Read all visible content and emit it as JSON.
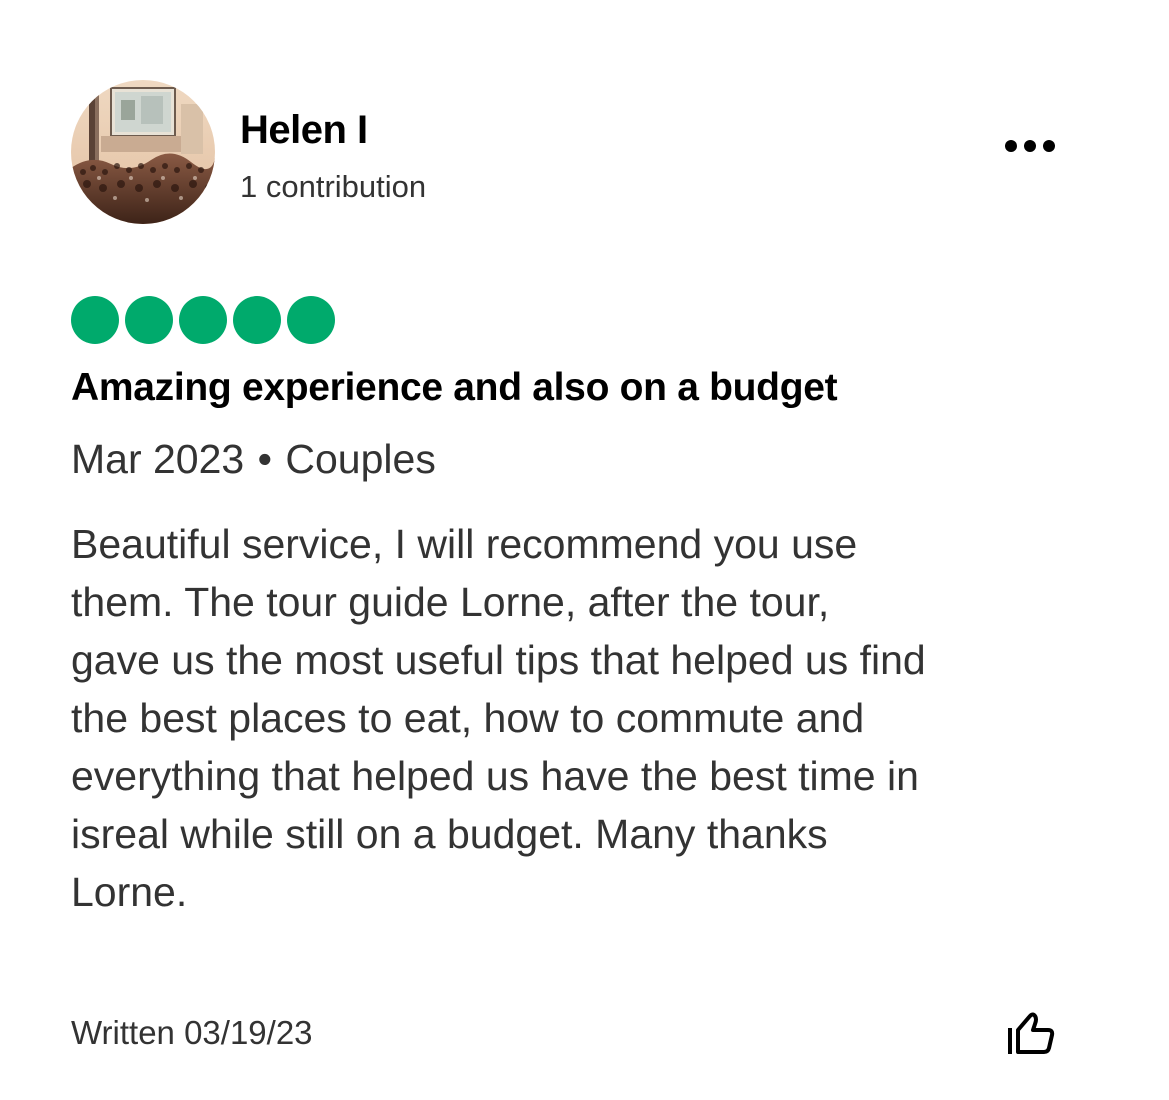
{
  "user": {
    "name": "Helen I",
    "contributions": "1 contribution",
    "avatar_icon": "concert-crowd-photo"
  },
  "menu": {
    "icon": "more-options-icon"
  },
  "review": {
    "rating": 5,
    "rating_max": 5,
    "rating_color": "#00aa6c",
    "title": "Amazing experience and also on a budget",
    "date": "Mar 2023",
    "separator": "•",
    "trip_type": "Couples",
    "body_lines": [
      "Beautiful service, I will recommend you use",
      "them. The tour guide Lorne, after the tour,",
      "gave us the most useful tips that helped us find",
      "the best places to eat, how to commute and",
      "everything that helped us have the best time in",
      "isreal while still on a budget. Many thanks",
      "Lorne."
    ],
    "written": "Written 03/19/23"
  },
  "actions": {
    "like_icon": "thumbs-up-icon"
  }
}
